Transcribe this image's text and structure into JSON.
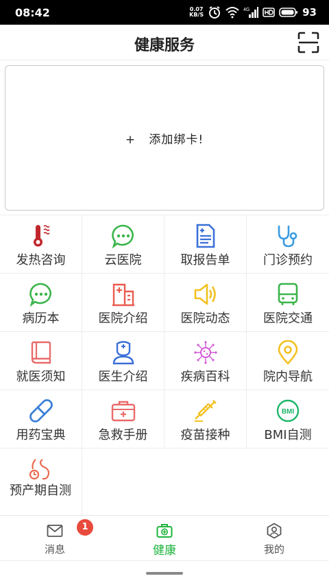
{
  "status_bar": {
    "time": "08:42",
    "net_speed_value": "0.07",
    "net_speed_unit": "KB/S",
    "network_type": "4G",
    "battery": "93"
  },
  "header": {
    "title": "健康服务",
    "scan_icon": "scan-icon"
  },
  "card": {
    "label": "+   添加绑卡!"
  },
  "grid": {
    "items": [
      {
        "label": "发热咨询",
        "icon": "thermometer-icon",
        "color": "#c0262b"
      },
      {
        "label": "云医院",
        "icon": "chat-bubble-icon",
        "color": "#3ab54a"
      },
      {
        "label": "取报告单",
        "icon": "report-document-icon",
        "color": "#3a6fd8"
      },
      {
        "label": "门诊预约",
        "icon": "stethoscope-icon",
        "color": "#3a9be0"
      },
      {
        "label": "病历本",
        "icon": "chat-bubble-icon",
        "color": "#3ab54a"
      },
      {
        "label": "医院介绍",
        "icon": "hospital-building-icon",
        "color": "#ea5a4e"
      },
      {
        "label": "医院动态",
        "icon": "speaker-icon",
        "color": "#f2c11f"
      },
      {
        "label": "医院交通",
        "icon": "bus-icon",
        "color": "#3ab54a"
      },
      {
        "label": "就医须知",
        "icon": "book-icon",
        "color": "#ea6a6a"
      },
      {
        "label": "医生介绍",
        "icon": "doctor-icon",
        "color": "#3a6fd8"
      },
      {
        "label": "疾病百科",
        "icon": "virus-icon",
        "color": "#d35ad8"
      },
      {
        "label": "院内导航",
        "icon": "location-pin-icon",
        "color": "#f2c11f"
      },
      {
        "label": "用药宝典",
        "icon": "pill-capsule-icon",
        "color": "#3a7fd8"
      },
      {
        "label": "急救手册",
        "icon": "first-aid-kit-icon",
        "color": "#ea6a6a"
      },
      {
        "label": "疫苗接种",
        "icon": "syringe-icon",
        "color": "#f2c11f"
      },
      {
        "label": "BMI自测",
        "icon": "bmi-icon",
        "color": "#1db56a"
      },
      {
        "label": "预产期自测",
        "icon": "pregnancy-icon",
        "color": "#ea6a4e"
      }
    ]
  },
  "tabbar": {
    "tabs": [
      {
        "label": "消息",
        "icon": "mail-icon",
        "badge": "1"
      },
      {
        "label": "健康",
        "icon": "medical-kit-icon"
      },
      {
        "label": "我的",
        "icon": "user-profile-icon"
      }
    ],
    "active_color": "#1db53d"
  }
}
